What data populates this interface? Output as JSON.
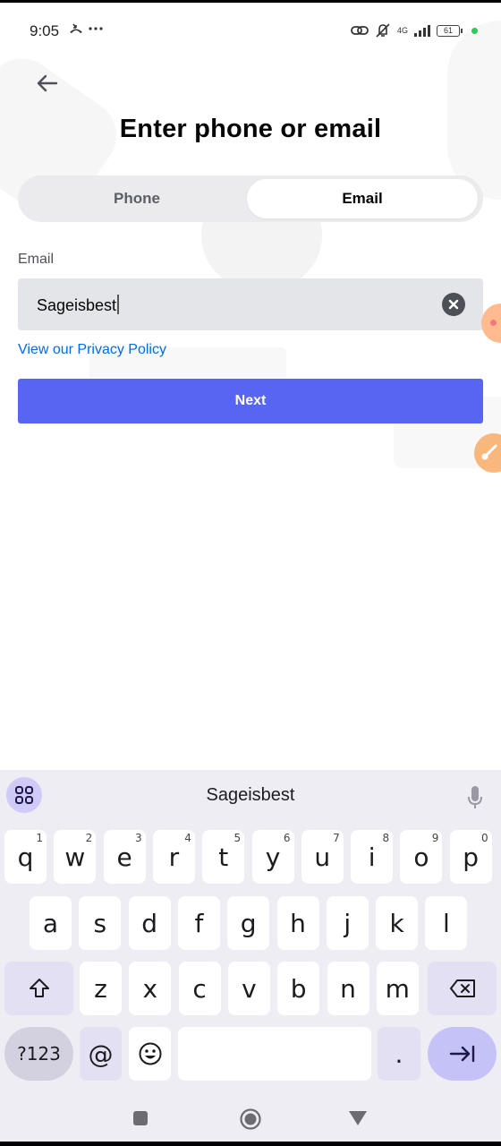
{
  "status_bar": {
    "time": "9:05",
    "left_icons": [
      "missed-call-icon",
      "more-dots-icon"
    ],
    "network": "4G",
    "battery": "61",
    "right_icons": [
      "link-icon",
      "silent-bell-icon",
      "signal-icon",
      "battery-icon",
      "privacy-dot"
    ]
  },
  "header": {
    "back_icon": "arrow-left-icon",
    "title": "Enter phone or email"
  },
  "tabs": [
    {
      "label": "Phone",
      "selected": false
    },
    {
      "label": "Email",
      "selected": true
    }
  ],
  "form": {
    "field_label": "Email",
    "input_value": "Sageisbest",
    "clear_icon": "clear-circle-icon",
    "privacy_link": "View our Privacy Policy",
    "next_label": "Next"
  },
  "colors": {
    "brand": "#5865f2",
    "link": "#006ce7",
    "input_bg": "#e3e5e8"
  },
  "keyboard": {
    "suggestion": "Sageisbest",
    "row1": [
      {
        "k": "q",
        "h": "1"
      },
      {
        "k": "w",
        "h": "2"
      },
      {
        "k": "e",
        "h": "3"
      },
      {
        "k": "r",
        "h": "4"
      },
      {
        "k": "t",
        "h": "5"
      },
      {
        "k": "y",
        "h": "6"
      },
      {
        "k": "u",
        "h": "7"
      },
      {
        "k": "i",
        "h": "8"
      },
      {
        "k": "o",
        "h": "9"
      },
      {
        "k": "p",
        "h": "0"
      }
    ],
    "row2": [
      "a",
      "s",
      "d",
      "f",
      "g",
      "h",
      "j",
      "k",
      "l"
    ],
    "row3": [
      "z",
      "x",
      "c",
      "v",
      "b",
      "n",
      "m"
    ],
    "symbols_label": "?123",
    "at_label": "@",
    "emoji_label": "☺",
    "period_label": "."
  },
  "nav_bar": {
    "buttons": [
      "recents",
      "home",
      "back"
    ]
  }
}
